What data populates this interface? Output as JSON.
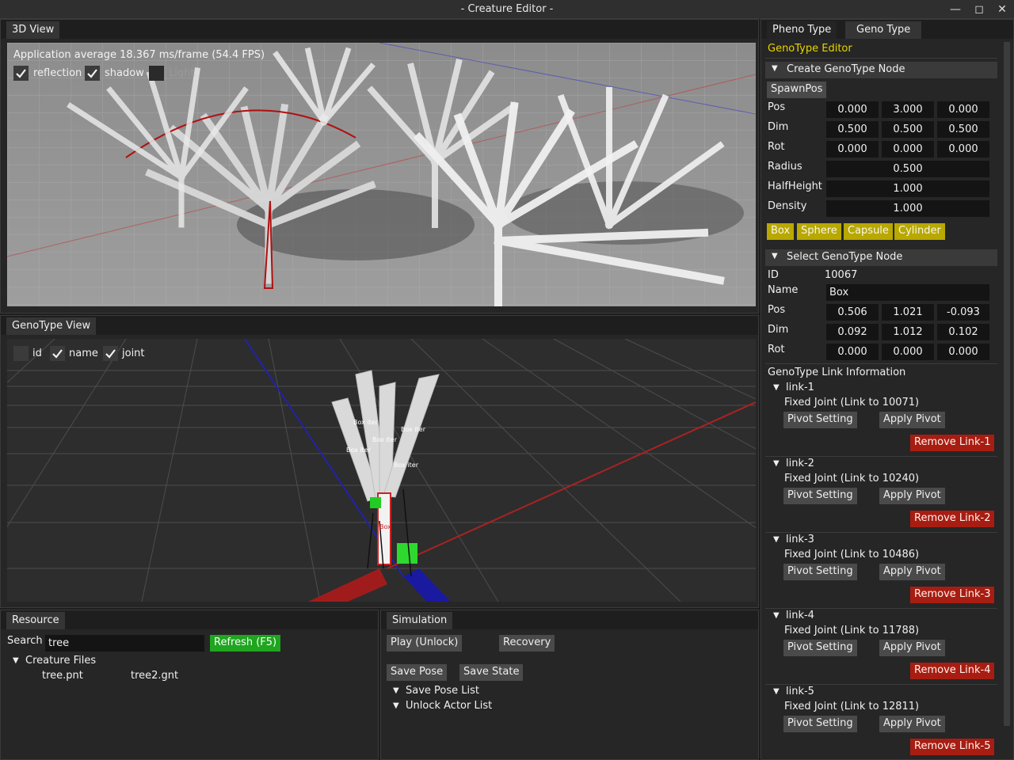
{
  "window": {
    "title": "- Creature Editor -",
    "minimize": "—",
    "maximize": "◻",
    "close": "✕"
  },
  "view3d": {
    "tab": "3D View",
    "fps": "Application average 18.367 ms/frame (54.4 FPS)",
    "reflection": "reflection",
    "shadow": "shadow",
    "third": "Light"
  },
  "genoview": {
    "tab": "GenoType View",
    "id": "id",
    "name": "name",
    "joint": "joint",
    "labels": [
      "Box iter",
      "Box iter",
      "Box iter",
      "Box iter",
      "Box iter",
      "Box"
    ]
  },
  "resource": {
    "tab": "Resource",
    "search_label": "Search",
    "search_value": "tree",
    "refresh": "Refresh (F5)",
    "creature_files": "Creature Files",
    "files": [
      "tree.pnt",
      "tree2.gnt"
    ]
  },
  "simulation": {
    "tab": "Simulation",
    "play": "Play (Unlock)",
    "recovery": "Recovery",
    "save_pose": "Save Pose",
    "save_state": "Save State",
    "save_pose_list": "Save Pose List",
    "unlock_actor_list": "Unlock Actor List"
  },
  "right": {
    "tab_pheno": "Pheno Type",
    "tab_geno": "Geno Type",
    "editor_title": "GenoType Editor",
    "create_header": "Create GenoType Node",
    "spawnpos": "SpawnPos",
    "create": {
      "pos_label": "Pos",
      "pos": [
        "0.000",
        "3.000",
        "0.000"
      ],
      "dim_label": "Dim",
      "dim": [
        "0.500",
        "0.500",
        "0.500"
      ],
      "rot_label": "Rot",
      "rot": [
        "0.000",
        "0.000",
        "0.000"
      ],
      "radius_label": "Radius",
      "radius": "0.500",
      "halfheight_label": "HalfHeight",
      "halfheight": "1.000",
      "density_label": "Density",
      "density": "1.000"
    },
    "shapes": [
      "Box",
      "Sphere",
      "Capsule",
      "Cylinder"
    ],
    "select_header": "Select GenoType Node",
    "select": {
      "id_label": "ID",
      "id": "10067",
      "name_label": "Name",
      "name": "Box",
      "pos_label": "Pos",
      "pos": [
        "0.506",
        "1.021",
        "-0.093"
      ],
      "dim_label": "Dim",
      "dim": [
        "0.092",
        "1.012",
        "0.102"
      ],
      "rot_label": "Rot",
      "rot": [
        "0.000",
        "0.000",
        "0.000"
      ]
    },
    "link_info": "GenoType Link Information",
    "links": [
      {
        "name": "link-1",
        "desc": "Fixed Joint (Link to 10071)",
        "pivot": "Pivot Setting",
        "apply": "Apply Pivot",
        "remove": "Remove Link-1"
      },
      {
        "name": "link-2",
        "desc": "Fixed Joint (Link to 10240)",
        "pivot": "Pivot Setting",
        "apply": "Apply Pivot",
        "remove": "Remove Link-2"
      },
      {
        "name": "link-3",
        "desc": "Fixed Joint (Link to 10486)",
        "pivot": "Pivot Setting",
        "apply": "Apply Pivot",
        "remove": "Remove Link-3"
      },
      {
        "name": "link-4",
        "desc": "Fixed Joint (Link to 11788)",
        "pivot": "Pivot Setting",
        "apply": "Apply Pivot",
        "remove": "Remove Link-4"
      },
      {
        "name": "link-5",
        "desc": "Fixed Joint (Link to 12811)",
        "pivot": "Pivot Setting",
        "apply": "Apply Pivot",
        "remove": "Remove Link-5"
      }
    ]
  },
  "colors": {
    "yellow_button": "#b8a800",
    "green_button": "#1fa51f",
    "red_button": "#a81d12",
    "editor_title": "#e8d400"
  },
  "icons": {
    "check": "check-icon",
    "tree_arrow": "triangle-down-icon"
  }
}
